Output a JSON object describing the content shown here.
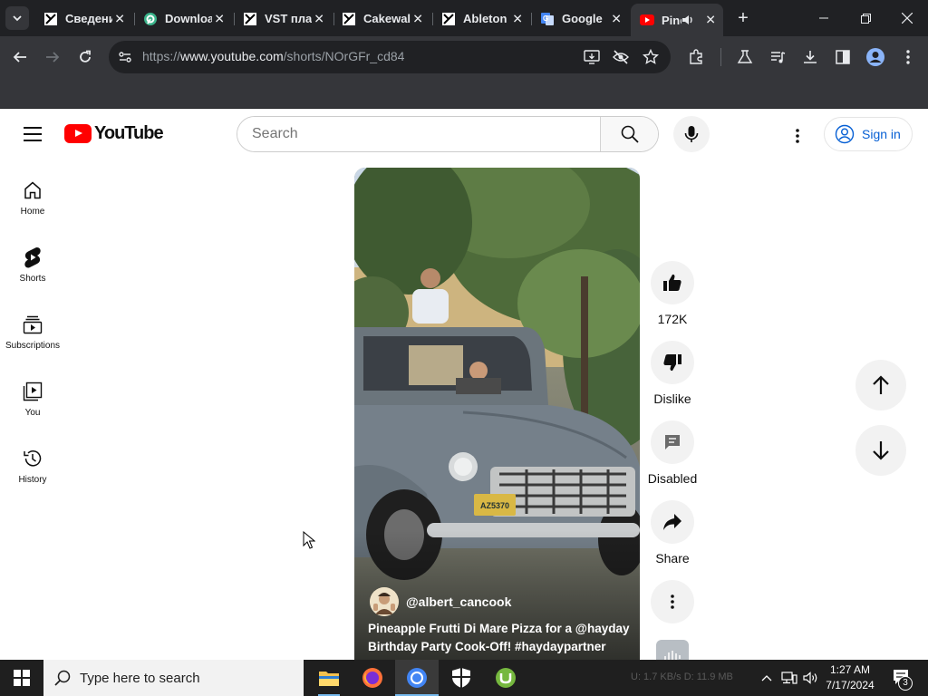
{
  "browser": {
    "tabs": [
      {
        "title": "Сведения",
        "icon": "document-icon"
      },
      {
        "title": "Download",
        "icon": "download-site-icon"
      },
      {
        "title": "VST плагин",
        "icon": "document-icon"
      },
      {
        "title": "Cakewalk",
        "icon": "document-icon"
      },
      {
        "title": "Ableton",
        "icon": "document-icon"
      },
      {
        "title": "Google",
        "icon": "google-translate-icon"
      },
      {
        "title": "Pineapple",
        "icon": "youtube-icon",
        "active": true,
        "audio": true
      }
    ],
    "new_tab_label": "+",
    "url_prefix": "https://",
    "url_domain": "www.youtube.com",
    "url_path": "/shorts/NOrGFr_cd84"
  },
  "youtube": {
    "logo_text": "YouTube",
    "search_placeholder": "Search",
    "sign_in_label": "Sign in",
    "sidebar": [
      {
        "label": "Home",
        "icon": "home-icon"
      },
      {
        "label": "Shorts",
        "icon": "shorts-icon"
      },
      {
        "label": "Subscriptions",
        "icon": "subscriptions-icon"
      },
      {
        "label": "You",
        "icon": "you-icon"
      },
      {
        "label": "History",
        "icon": "history-icon"
      }
    ],
    "short": {
      "channel": "@albert_cancook",
      "caption": "Pineapple Frutti Di Mare Pizza for a @hayday Birthday Party Cook-Off! #haydaypartner",
      "license_plate": "AZ5370",
      "actions": {
        "like_count": "172K",
        "dislike_label": "Dislike",
        "comments_label": "Disabled",
        "share_label": "Share"
      }
    }
  },
  "taskbar": {
    "search_placeholder": "Type here to search",
    "network_ghost": "U: 1.7 KB/s  D: 11.9 MB",
    "time": "1:27 AM",
    "date": "7/17/2024",
    "notifications_count": "3"
  }
}
